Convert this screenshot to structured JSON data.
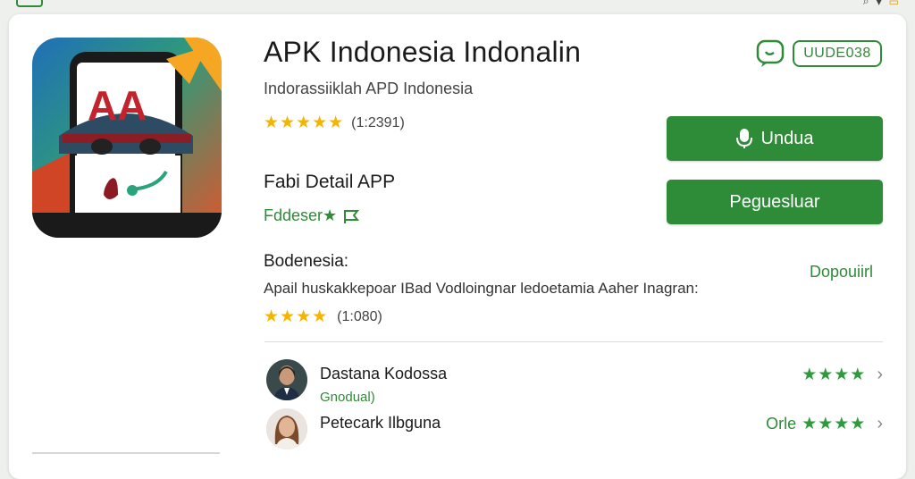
{
  "app": {
    "title": "APK Indonesia Indonalin",
    "subtitle": "Indorassiiklah APD Indonesia",
    "rating_stars": "★★★★★",
    "rating_count": "(1:2391)"
  },
  "badges": {
    "code": "UUDE038"
  },
  "buttons": {
    "download": "Undua",
    "secondary": "Peguesluar"
  },
  "detail": {
    "title": "Fabi Detail  APP",
    "developer": "Fddeser★",
    "developer_icon": "flag-icon"
  },
  "section": {
    "title": "Bodenesia:",
    "description": "Apail huskakkepoar IBad Vodloingnar ledoetamia Aaher Inagran:",
    "link": "Dopouiirl",
    "rating_stars": "★★★★",
    "rating_count": "(1:080)"
  },
  "reviews": [
    {
      "name": "Dastana Kodossa",
      "sub": "Gnodual)",
      "prefix": "",
      "stars": "★★★★"
    },
    {
      "name": "Petecark Ilbguna",
      "sub": "",
      "prefix": "Orle",
      "stars": "★★★★"
    }
  ],
  "colors": {
    "accent": "#2e8b37",
    "star": "#f4b400",
    "card": "#ffffff",
    "background": "#eef0ee"
  }
}
